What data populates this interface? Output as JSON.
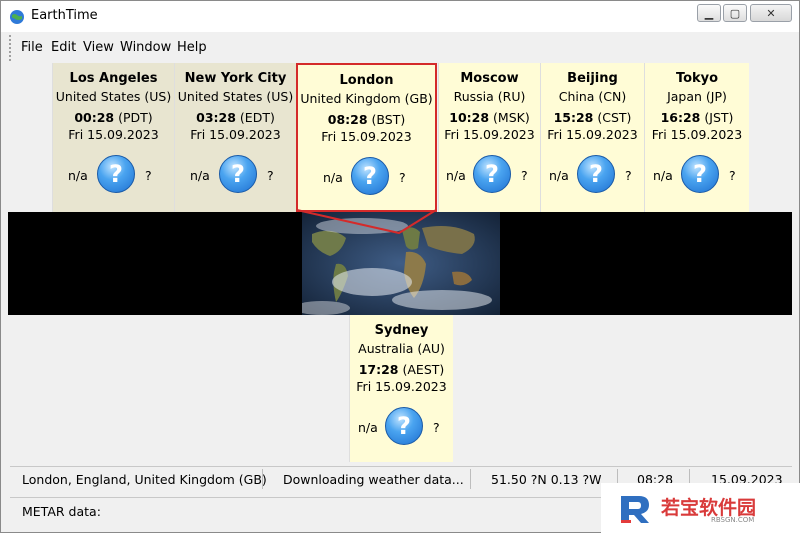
{
  "window": {
    "title": "EarthTime"
  },
  "menu": [
    "File",
    "Edit",
    "View",
    "Window",
    "Help"
  ],
  "tiles": [
    {
      "city": "Los Angeles",
      "country": "United States (US)",
      "time": "00:28",
      "zone": "(PDT)",
      "date": "Fri 15.09.2023",
      "weather_value": "n/a",
      "weather_icon": "?",
      "weather_extra": "?"
    },
    {
      "city": "New York City",
      "country": "United States (US)",
      "time": "03:28",
      "zone": "(EDT)",
      "date": "Fri 15.09.2023",
      "weather_value": "n/a",
      "weather_icon": "?",
      "weather_extra": "?"
    },
    {
      "city": "London",
      "country": "United Kingdom (GB)",
      "time": "08:28",
      "zone": "(BST)",
      "date": "Fri 15.09.2023",
      "weather_value": "n/a",
      "weather_icon": "?",
      "weather_extra": "?"
    },
    {
      "city": "Moscow",
      "country": "Russia (RU)",
      "time": "10:28",
      "zone": "(MSK)",
      "date": "Fri 15.09.2023",
      "weather_value": "n/a",
      "weather_icon": "?",
      "weather_extra": "?"
    },
    {
      "city": "Beijing",
      "country": "China (CN)",
      "time": "15:28",
      "zone": "(CST)",
      "date": "Fri 15.09.2023",
      "weather_value": "n/a",
      "weather_icon": "?",
      "weather_extra": "?"
    },
    {
      "city": "Tokyo",
      "country": "Japan (JP)",
      "time": "16:28",
      "zone": "(JST)",
      "date": "Fri 15.09.2023",
      "weather_value": "n/a",
      "weather_icon": "?",
      "weather_extra": "?"
    },
    {
      "city": "Sydney",
      "country": "Australia (AU)",
      "time": "17:28",
      "zone": "(AEST)",
      "date": "Fri 15.09.2023",
      "weather_value": "n/a",
      "weather_icon": "?",
      "weather_extra": "?"
    }
  ],
  "status": {
    "location": "London, England, United Kingdom (GB)",
    "message": "Downloading weather data...",
    "coords": "51.50 ?N  0.13 ?W",
    "time": "08:28",
    "date": "15.09.2023",
    "metar_label": "METAR data:"
  },
  "watermark": {
    "brand": "若宝软件园",
    "url": "RBSGN.COM"
  },
  "colors": {
    "tile_bg": "#fffcd6",
    "tile_dim_bg": "#e8e5d0",
    "selected_border": "#d42a2a",
    "bubble": "#2b86e4"
  }
}
